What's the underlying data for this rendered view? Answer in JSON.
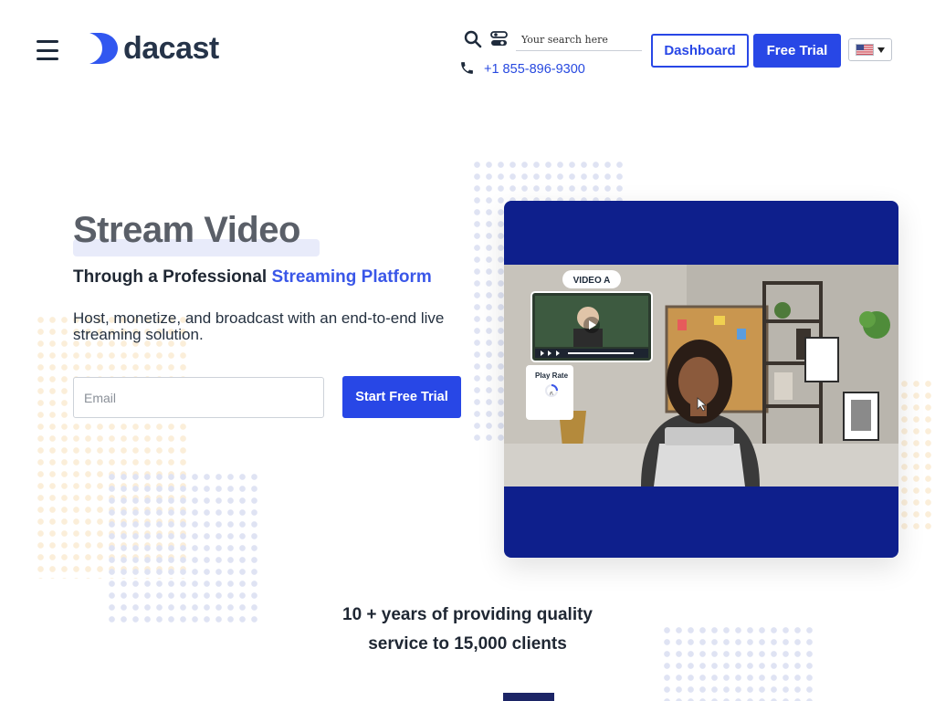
{
  "header": {
    "logo_text": "dacast",
    "search_placeholder": "Your search here",
    "phone": "+1 855-896-9300",
    "dashboard_label": "Dashboard",
    "free_trial_label": "Free Trial",
    "language": "en-US"
  },
  "hero": {
    "title": "Stream Video",
    "subtitle_prefix": "Through a Professional ",
    "subtitle_accent": "Streaming Platform",
    "description": "Host, monetize, and broadcast with an end-to-end live streaming solution.",
    "email_placeholder": "Email",
    "cta_label": "Start Free Trial"
  },
  "video": {
    "overlay_title": "VIDEO A",
    "play_rate_label": "Play Rate",
    "play_rate_value": "6"
  },
  "stats": {
    "line1": "10 + years of providing quality",
    "line2": "service to 15,000 clients"
  },
  "colors": {
    "brand_blue": "#2847e6",
    "logo_blue": "#3157f0",
    "card_navy": "#0e1f8c",
    "accent_text": "#3a57e8"
  },
  "icons": [
    "menu-icon",
    "search-icon",
    "toggle-icon",
    "phone-icon",
    "us-flag-icon",
    "chevron-down-icon",
    "play-icon",
    "cursor-icon"
  ]
}
